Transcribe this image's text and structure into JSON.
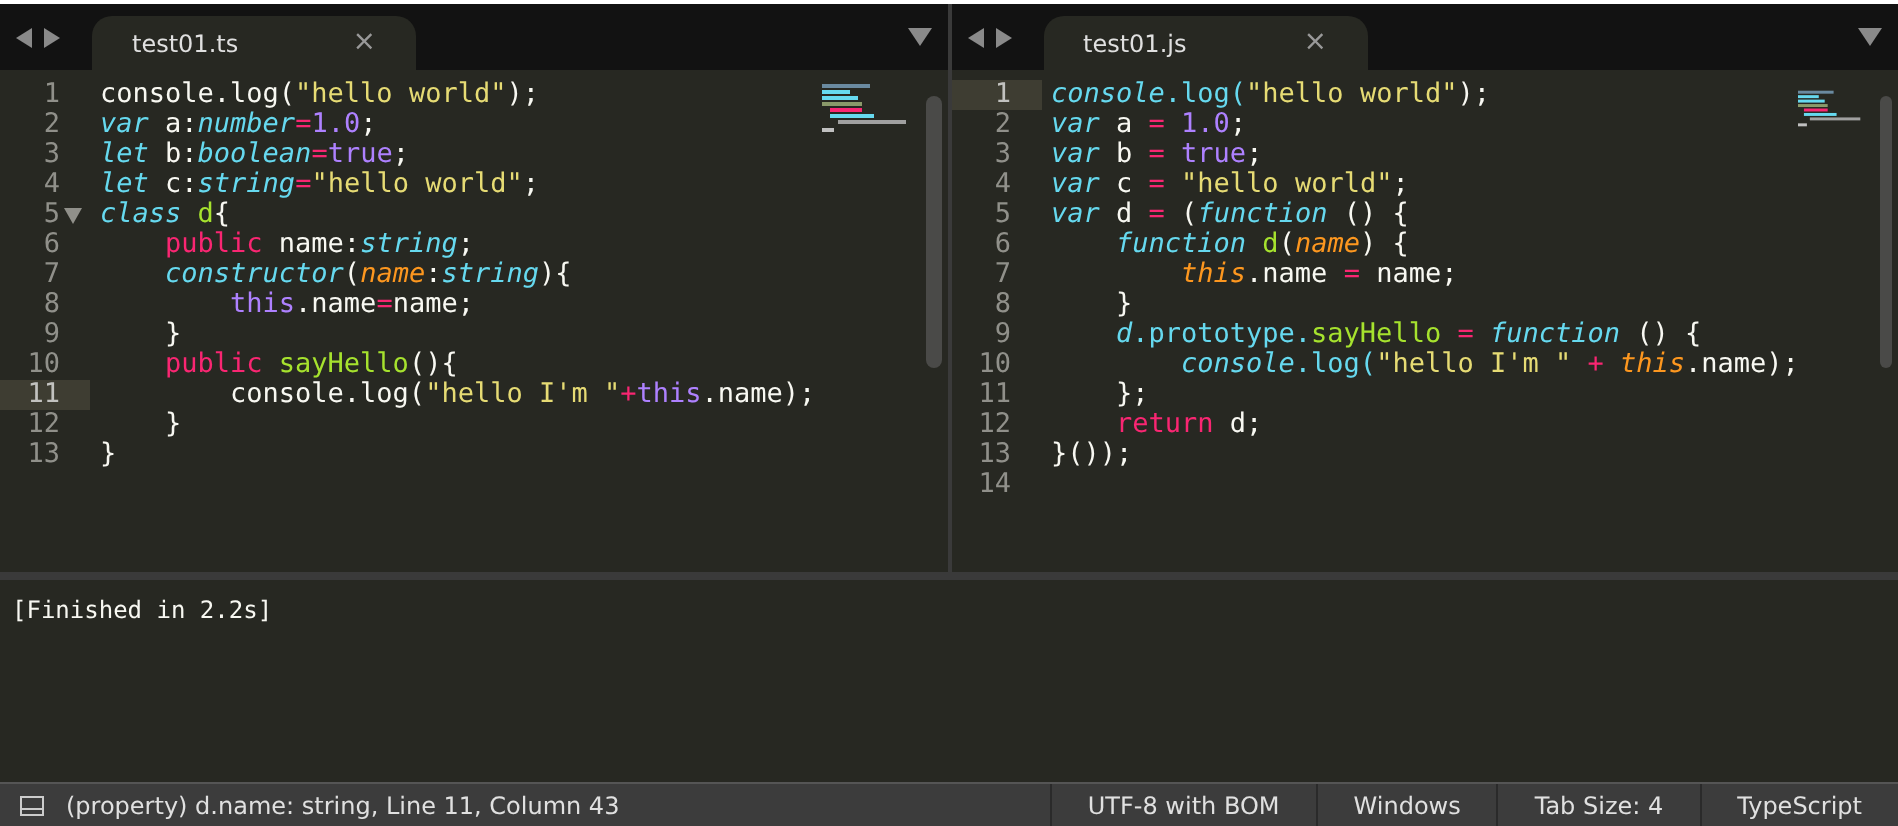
{
  "panes": [
    {
      "tab": {
        "title": "test01.ts",
        "close": "×",
        "selected": true
      },
      "lines": [
        {
          "number": "1",
          "current": false,
          "fold": false,
          "tokens": [
            {
              "text": "console.log(",
              "kind": "plain"
            },
            {
              "text": "\"hello world\"",
              "kind": "string"
            },
            {
              "text": ");",
              "kind": "plain"
            }
          ]
        },
        {
          "number": "2",
          "current": false,
          "fold": false,
          "tokens": [
            {
              "text": "var",
              "kind": "storage"
            },
            {
              "text": " a:",
              "kind": "plain"
            },
            {
              "text": "number",
              "kind": "storage"
            },
            {
              "text": "=",
              "kind": "keyword"
            },
            {
              "text": "1.0",
              "kind": "constant"
            },
            {
              "text": ";",
              "kind": "plain"
            }
          ]
        },
        {
          "number": "3",
          "current": false,
          "fold": false,
          "tokens": [
            {
              "text": "let",
              "kind": "storage"
            },
            {
              "text": " b:",
              "kind": "plain"
            },
            {
              "text": "boolean",
              "kind": "storage"
            },
            {
              "text": "=",
              "kind": "keyword"
            },
            {
              "text": "true",
              "kind": "constant"
            },
            {
              "text": ";",
              "kind": "plain"
            }
          ]
        },
        {
          "number": "4",
          "current": false,
          "fold": false,
          "tokens": [
            {
              "text": "let",
              "kind": "storage"
            },
            {
              "text": " c:",
              "kind": "plain"
            },
            {
              "text": "string",
              "kind": "storage"
            },
            {
              "text": "=",
              "kind": "keyword"
            },
            {
              "text": "\"hello world\"",
              "kind": "string"
            },
            {
              "text": ";",
              "kind": "plain"
            }
          ]
        },
        {
          "number": "5",
          "current": false,
          "fold": true,
          "tokens": [
            {
              "text": "class ",
              "kind": "storage"
            },
            {
              "text": "d",
              "kind": "entity"
            },
            {
              "text": "{",
              "kind": "plain"
            }
          ]
        },
        {
          "number": "6",
          "current": false,
          "fold": false,
          "tokens": [
            {
              "text": "    public",
              "kind": "keyword"
            },
            {
              "text": " name:",
              "kind": "plain"
            },
            {
              "text": "string",
              "kind": "storage"
            },
            {
              "text": ";",
              "kind": "plain"
            }
          ]
        },
        {
          "number": "7",
          "current": false,
          "fold": false,
          "tokens": [
            {
              "text": "    constructor",
              "kind": "storage"
            },
            {
              "text": "(",
              "kind": "plain"
            },
            {
              "text": "name",
              "kind": "param"
            },
            {
              "text": ":",
              "kind": "plain"
            },
            {
              "text": "string",
              "kind": "storage"
            },
            {
              "text": "){",
              "kind": "plain"
            }
          ]
        },
        {
          "number": "8",
          "current": false,
          "fold": false,
          "tokens": [
            {
              "text": "        this",
              "kind": "constant"
            },
            {
              "text": ".name",
              "kind": "plain"
            },
            {
              "text": "=",
              "kind": "keyword"
            },
            {
              "text": "name;",
              "kind": "plain"
            }
          ]
        },
        {
          "number": "9",
          "current": false,
          "fold": false,
          "tokens": [
            {
              "text": "    }",
              "kind": "plain"
            }
          ]
        },
        {
          "number": "10",
          "current": false,
          "fold": false,
          "tokens": [
            {
              "text": "    public ",
              "kind": "keyword"
            },
            {
              "text": "sayHello",
              "kind": "entity"
            },
            {
              "text": "(){",
              "kind": "plain"
            }
          ]
        },
        {
          "number": "11",
          "current": true,
          "fold": false,
          "tokens": [
            {
              "text": "        console.log(",
              "kind": "plain"
            },
            {
              "text": "\"hello I'm \"",
              "kind": "string"
            },
            {
              "text": "+",
              "kind": "keyword"
            },
            {
              "text": "this",
              "kind": "constant"
            },
            {
              "text": ".name);",
              "kind": "plain"
            }
          ]
        },
        {
          "number": "12",
          "current": false,
          "fold": false,
          "tokens": [
            {
              "text": "    }",
              "kind": "plain"
            }
          ]
        },
        {
          "number": "13",
          "current": false,
          "fold": false,
          "tokens": [
            {
              "text": "}",
              "kind": "plain"
            }
          ]
        }
      ]
    },
    {
      "tab": {
        "title": "test01.js",
        "close": "×",
        "selected": true
      },
      "lines": [
        {
          "number": "1",
          "current": true,
          "fold": false,
          "tokens": [
            {
              "text": "console",
              "kind": "storage"
            },
            {
              "text": ".log(",
              "kind": "support"
            },
            {
              "text": "\"hello world\"",
              "kind": "string"
            },
            {
              "text": ");",
              "kind": "plain"
            }
          ]
        },
        {
          "number": "2",
          "current": false,
          "fold": false,
          "tokens": [
            {
              "text": "var",
              "kind": "storage"
            },
            {
              "text": " a ",
              "kind": "plain"
            },
            {
              "text": "= ",
              "kind": "keyword"
            },
            {
              "text": "1.0",
              "kind": "constant"
            },
            {
              "text": ";",
              "kind": "plain"
            }
          ]
        },
        {
          "number": "3",
          "current": false,
          "fold": false,
          "tokens": [
            {
              "text": "var",
              "kind": "storage"
            },
            {
              "text": " b ",
              "kind": "plain"
            },
            {
              "text": "= ",
              "kind": "keyword"
            },
            {
              "text": "true",
              "kind": "constant"
            },
            {
              "text": ";",
              "kind": "plain"
            }
          ]
        },
        {
          "number": "4",
          "current": false,
          "fold": false,
          "tokens": [
            {
              "text": "var",
              "kind": "storage"
            },
            {
              "text": " c ",
              "kind": "plain"
            },
            {
              "text": "= ",
              "kind": "keyword"
            },
            {
              "text": "\"hello world\"",
              "kind": "string"
            },
            {
              "text": ";",
              "kind": "plain"
            }
          ]
        },
        {
          "number": "5",
          "current": false,
          "fold": false,
          "tokens": [
            {
              "text": "var",
              "kind": "storage"
            },
            {
              "text": " d ",
              "kind": "plain"
            },
            {
              "text": "=",
              "kind": "keyword"
            },
            {
              "text": " (",
              "kind": "plain"
            },
            {
              "text": "function",
              "kind": "storage"
            },
            {
              "text": " () {",
              "kind": "plain"
            }
          ]
        },
        {
          "number": "6",
          "current": false,
          "fold": false,
          "tokens": [
            {
              "text": "    function ",
              "kind": "storage"
            },
            {
              "text": "d",
              "kind": "entity"
            },
            {
              "text": "(",
              "kind": "plain"
            },
            {
              "text": "name",
              "kind": "param"
            },
            {
              "text": ") {",
              "kind": "plain"
            }
          ]
        },
        {
          "number": "7",
          "current": false,
          "fold": false,
          "tokens": [
            {
              "text": "        this",
              "kind": "param"
            },
            {
              "text": ".name ",
              "kind": "plain"
            },
            {
              "text": "=",
              "kind": "keyword"
            },
            {
              "text": " name;",
              "kind": "plain"
            }
          ]
        },
        {
          "number": "8",
          "current": false,
          "fold": false,
          "tokens": [
            {
              "text": "    }",
              "kind": "plain"
            }
          ]
        },
        {
          "number": "9",
          "current": false,
          "fold": false,
          "tokens": [
            {
              "text": "    d",
              "kind": "storage"
            },
            {
              "text": ".prototype.",
              "kind": "support"
            },
            {
              "text": "sayHello ",
              "kind": "entity"
            },
            {
              "text": "= ",
              "kind": "keyword"
            },
            {
              "text": "function",
              "kind": "storage"
            },
            {
              "text": " () {",
              "kind": "plain"
            }
          ]
        },
        {
          "number": "10",
          "current": false,
          "fold": false,
          "tokens": [
            {
              "text": "        console",
              "kind": "storage"
            },
            {
              "text": ".log(",
              "kind": "support"
            },
            {
              "text": "\"hello I'm \" ",
              "kind": "string"
            },
            {
              "text": "+ ",
              "kind": "keyword"
            },
            {
              "text": "this",
              "kind": "param"
            },
            {
              "text": ".name);",
              "kind": "plain"
            }
          ]
        },
        {
          "number": "11",
          "current": false,
          "fold": false,
          "tokens": [
            {
              "text": "    };",
              "kind": "plain"
            }
          ]
        },
        {
          "number": "12",
          "current": false,
          "fold": false,
          "tokens": [
            {
              "text": "    return",
              "kind": "keyword"
            },
            {
              "text": " d;",
              "kind": "plain"
            }
          ]
        },
        {
          "number": "13",
          "current": false,
          "fold": false,
          "tokens": [
            {
              "text": "}());",
              "kind": "plain"
            }
          ]
        },
        {
          "number": "14",
          "current": false,
          "fold": false
        }
      ]
    }
  ],
  "output": {
    "text": "[Finished in 2.2s]"
  },
  "status_bar": {
    "message": "(property) d.name: string, Line 11, Column 43",
    "items": [
      "UTF-8 with BOM",
      "Windows",
      "Tab Size: 4",
      "TypeScript"
    ]
  }
}
